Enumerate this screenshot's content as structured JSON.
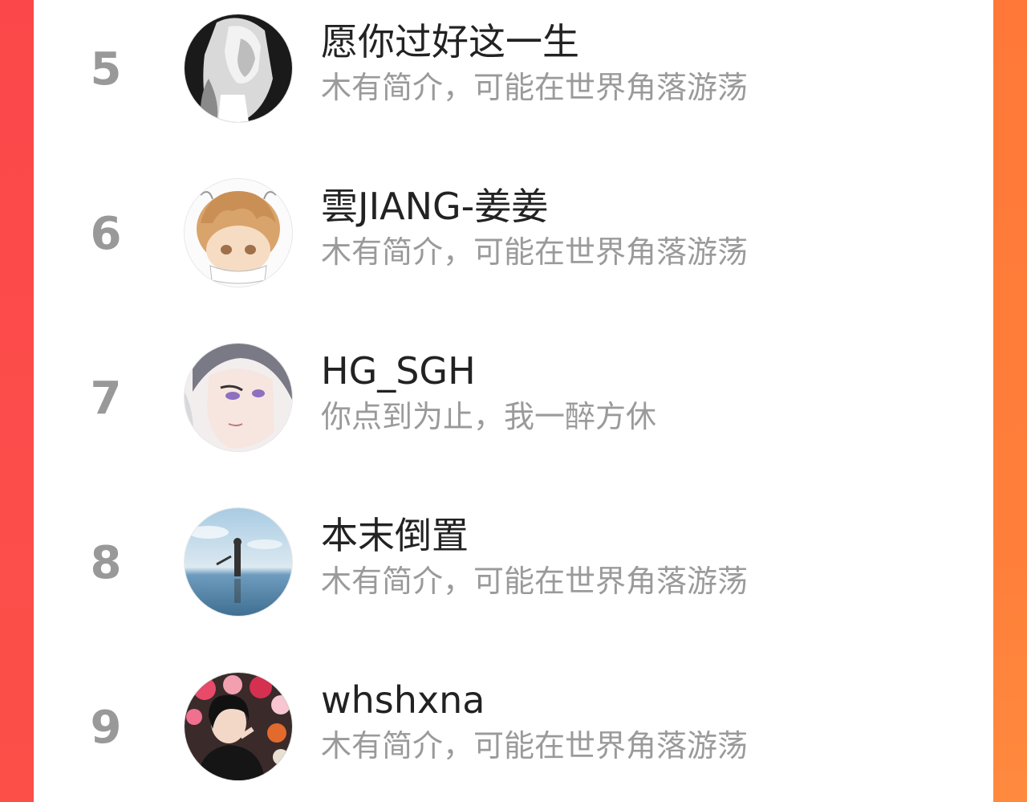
{
  "ranking": {
    "items": [
      {
        "rank": "5",
        "name": "愿你过好这一生",
        "bio": "木有简介，可能在世界角落游荡",
        "avatar_icon": "avatar-girl-monochrome-hair"
      },
      {
        "rank": "6",
        "name": "雲JIANG-姜姜",
        "bio": "木有简介，可能在世界角落游荡",
        "avatar_icon": "avatar-anime-boy-cute"
      },
      {
        "rank": "7",
        "name": "HG_SGH",
        "bio": "你点到为止，我一醉方休",
        "avatar_icon": "avatar-anime-man-purple-eyes"
      },
      {
        "rank": "8",
        "name": "本末倒置",
        "bio": "木有简介，可能在世界角落游荡",
        "avatar_icon": "avatar-person-sky-water"
      },
      {
        "rank": "9",
        "name": "whshxna",
        "bio": "木有简介，可能在世界角落游荡",
        "avatar_icon": "avatar-girl-flowers"
      }
    ]
  },
  "colors": {
    "background_left": "#fb4a4c",
    "background_right": "#ff7a3a",
    "panel": "#ffffff",
    "rank_text": "#999999",
    "name_text": "#222222",
    "bio_text": "#9a9a9a"
  }
}
